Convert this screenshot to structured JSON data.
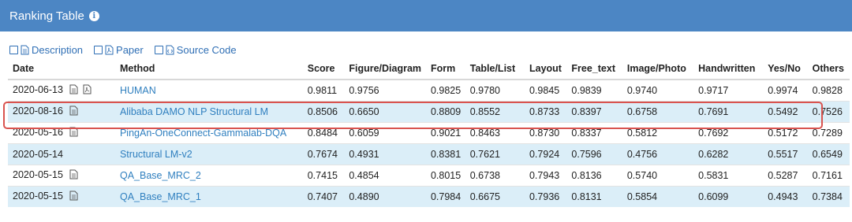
{
  "header": {
    "title": "Ranking Table",
    "info_icon": "info-circle-icon"
  },
  "legend": [
    {
      "label": "Description",
      "icon": "document-icon"
    },
    {
      "label": "Paper",
      "icon": "pdf-icon"
    },
    {
      "label": "Source Code",
      "icon": "code-icon"
    }
  ],
  "table": {
    "columns": [
      "Date",
      "Method",
      "Score",
      "Figure/Diagram",
      "Form",
      "Table/List",
      "Layout",
      "Free_text",
      "Image/Photo",
      "Handwritten",
      "Yes/No",
      "Others"
    ],
    "rows": [
      {
        "date": "2020-06-13",
        "icons": [
          "document-icon",
          "pdf-icon"
        ],
        "method": "HUMAN",
        "values": [
          "0.9811",
          "0.9756",
          "0.9825",
          "0.9780",
          "0.9845",
          "0.9839",
          "0.9740",
          "0.9717",
          "0.9974",
          "0.9828"
        ]
      },
      {
        "date": "2020-08-16",
        "icons": [
          "document-icon"
        ],
        "method": "Alibaba DAMO NLP Structural LM",
        "values": [
          "0.8506",
          "0.6650",
          "0.8809",
          "0.8552",
          "0.8733",
          "0.8397",
          "0.6758",
          "0.7691",
          "0.5492",
          "0.7526"
        ],
        "highlighted": true
      },
      {
        "date": "2020-05-16",
        "icons": [
          "document-icon"
        ],
        "method": "PingAn-OneConnect-Gammalab-DQA",
        "values": [
          "0.8484",
          "0.6059",
          "0.9021",
          "0.8463",
          "0.8730",
          "0.8337",
          "0.5812",
          "0.7692",
          "0.5172",
          "0.7289"
        ]
      },
      {
        "date": "2020-05-14",
        "icons": [],
        "method": "Structural LM-v2",
        "values": [
          "0.7674",
          "0.4931",
          "0.8381",
          "0.7621",
          "0.7924",
          "0.7596",
          "0.4756",
          "0.6282",
          "0.5517",
          "0.6549"
        ]
      },
      {
        "date": "2020-05-15",
        "icons": [
          "document-icon"
        ],
        "method": "QA_Base_MRC_2",
        "values": [
          "0.7415",
          "0.4854",
          "0.8015",
          "0.6738",
          "0.7943",
          "0.8136",
          "0.5740",
          "0.5831",
          "0.5287",
          "0.7161"
        ]
      },
      {
        "date": "2020-05-15",
        "icons": [
          "document-icon"
        ],
        "method": "QA_Base_MRC_1",
        "values": [
          "0.7407",
          "0.4890",
          "0.7984",
          "0.6675",
          "0.7936",
          "0.8131",
          "0.5854",
          "0.6099",
          "0.4943",
          "0.7384"
        ]
      }
    ]
  },
  "colors": {
    "header_bg": "#4c86c4",
    "link": "#2f7fbf",
    "alt_row": "#dbeef8",
    "highlight": "#d9534f"
  }
}
